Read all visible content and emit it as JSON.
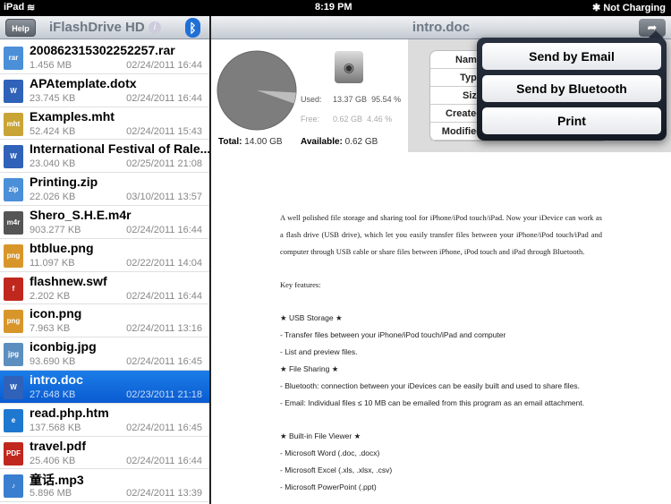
{
  "status": {
    "device": "iPad",
    "time": "8:19 PM",
    "battery": "Not Charging"
  },
  "left": {
    "help": "Help",
    "title": "iFlashDrive HD"
  },
  "files": [
    {
      "name": "200862315302252257.rar",
      "size": "1.456 MB",
      "date": "02/24/2011 16:44",
      "icon": "rar",
      "color": "#4a8fd8"
    },
    {
      "name": "APAtemplate.dotx",
      "size": "23.745 KB",
      "date": "02/24/2011 16:44",
      "icon": "W",
      "color": "#2f62b8"
    },
    {
      "name": "Examples.mht",
      "size": "52.424 KB",
      "date": "02/24/2011 15:43",
      "icon": "mht",
      "color": "#c9a436"
    },
    {
      "name": "International Festival of Rale...",
      "size": "23.040 KB",
      "date": "02/25/2011 21:08",
      "icon": "W",
      "color": "#2f62b8"
    },
    {
      "name": "Printing.zip",
      "size": "22.026 KB",
      "date": "03/10/2011 13:57",
      "icon": "zip",
      "color": "#4a8fd8"
    },
    {
      "name": "Shero_S.H.E.m4r",
      "size": "903.277 KB",
      "date": "02/24/2011 16:44",
      "icon": "m4r",
      "color": "#555"
    },
    {
      "name": "btblue.png",
      "size": "11.097 KB",
      "date": "02/22/2011 14:04",
      "icon": "png",
      "color": "#d8962a"
    },
    {
      "name": "flashnew.swf",
      "size": "2.202 KB",
      "date": "02/24/2011 16:44",
      "icon": "f",
      "color": "#c0281e"
    },
    {
      "name": "icon.png",
      "size": "7.963 KB",
      "date": "02/24/2011 13:16",
      "icon": "png",
      "color": "#d8962a"
    },
    {
      "name": "iconbig.jpg",
      "size": "93.690 KB",
      "date": "02/24/2011 16:45",
      "icon": "jpg",
      "color": "#5c8fc0"
    },
    {
      "name": "intro.doc",
      "size": "27.648 KB",
      "date": "02/23/2011 21:18",
      "icon": "W",
      "color": "#2f62b8"
    },
    {
      "name": "read.php.htm",
      "size": "137.568 KB",
      "date": "02/24/2011 16:45",
      "icon": "e",
      "color": "#1f78d0"
    },
    {
      "name": "travel.pdf",
      "size": "25.406 KB",
      "date": "02/24/2011 16:44",
      "icon": "PDF",
      "color": "#c0281e"
    },
    {
      "name": "童话.mp3",
      "size": "5.896 MB",
      "date": "02/24/2011 13:39",
      "icon": "♪",
      "color": "#3a7ed0"
    }
  ],
  "right": {
    "title": "intro.doc",
    "storage": {
      "used_label": "Used:",
      "used": "13.37 GB",
      "used_pct": "95.54 %",
      "used_fraction": 0.9554,
      "free_label": "Free:",
      "free": "0.62 GB",
      "free_pct": "4.46 %",
      "total_label": "Total:",
      "total": "14.00 GB",
      "available_label": "Available:",
      "available": "0.62 GB"
    },
    "info_labels": [
      "Name",
      "Type",
      "Size",
      "Created",
      "Modified"
    ],
    "doc": {
      "intro": "A well polished file storage and sharing tool for iPhone/iPod touch/iPad. Now your iDevice can work as a flash drive (USB drive), which let you easily transfer files between your iPhone/iPod touch/iPad and computer through USB cable or share files between iPhone, iPod touch and iPad through Bluetooth.",
      "key": "Key features:",
      "lines": [
        "★ USB Storage ★",
        "- Transfer files between your iPhone/iPod touch/iPad and computer",
        "- List and preview files.",
        "★ File Sharing ★",
        "- Bluetooth: connection between your iDevices can be easily built and used to share files.",
        "- Email: Individual files ≤ 10 MB can be emailed from this program as an email attachment."
      ],
      "lines2": [
        "★ Built-in File Viewer ★",
        "- Microsoft Word (.doc, .docx)",
        "- Microsoft Excel (.xls, .xlsx, .csv)",
        "- Microsoft PowerPoint (.ppt)"
      ]
    }
  },
  "popover": {
    "email": "Send by Email",
    "bluetooth": "Send by Bluetooth",
    "print": "Print"
  }
}
